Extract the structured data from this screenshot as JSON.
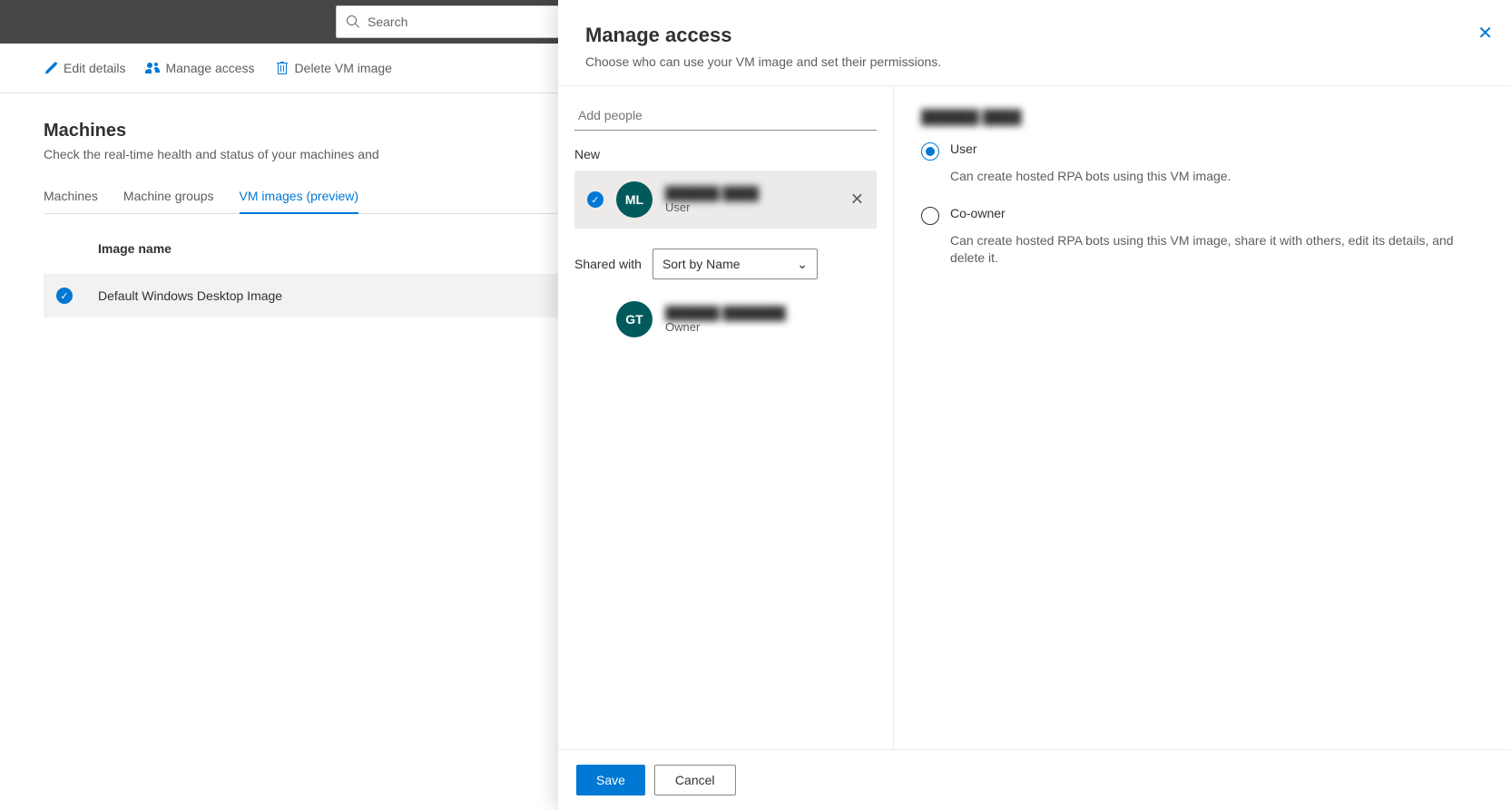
{
  "search": {
    "placeholder": "Search"
  },
  "toolbar": {
    "edit_label": "Edit details",
    "manage_label": "Manage access",
    "delete_label": "Delete VM image"
  },
  "page": {
    "title": "Machines",
    "subtitle": "Check the real-time health and status of your machines and"
  },
  "tabs": {
    "machines": "Machines",
    "groups": "Machine groups",
    "images": "VM images (preview)"
  },
  "table": {
    "col_image_name": "Image name",
    "row0_name": "Default Windows Desktop Image"
  },
  "panel": {
    "title": "Manage access",
    "subtitle": "Choose who can use your VM image and set their permissions.",
    "add_placeholder": "Add people",
    "new_label": "New",
    "shared_label": "Shared with",
    "sort_value": "Sort by Name",
    "save_label": "Save",
    "cancel_label": "Cancel"
  },
  "people": {
    "new0": {
      "initials": "ML",
      "name": "██████ ████",
      "role": "User"
    },
    "shared0": {
      "initials": "GT",
      "name": "██████ ███████",
      "role": "Owner"
    }
  },
  "perm": {
    "selected_name": "██████ ████",
    "user_label": "User",
    "user_desc": "Can create hosted RPA bots using this VM image.",
    "coowner_label": "Co-owner",
    "coowner_desc": "Can create hosted RPA bots using this VM image, share it with others, edit its details, and delete it."
  }
}
